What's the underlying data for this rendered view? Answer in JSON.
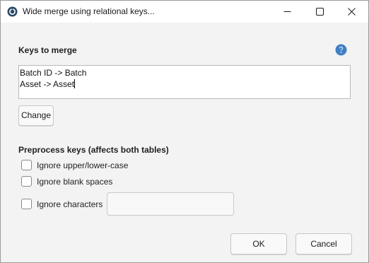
{
  "window": {
    "title": "Wide merge using relational keys...",
    "icons": {
      "app": "app-logo-icon",
      "minimize": "minimize-icon",
      "maximize": "maximize-icon",
      "close": "close-icon"
    }
  },
  "keys_section": {
    "label": "Keys to merge",
    "help_icon": "question-mark-icon",
    "help_color": "#3f7fc4",
    "keys": [
      "Batch ID -> Batch",
      "Asset -> Asset"
    ],
    "change_button": "Change"
  },
  "preprocess_section": {
    "label": "Preprocess keys (affects both tables)",
    "options": [
      {
        "label": "Ignore upper/lower-case",
        "checked": false
      },
      {
        "label": "Ignore blank spaces",
        "checked": false
      },
      {
        "label": "Ignore characters",
        "checked": false
      }
    ],
    "ignore_characters_value": ""
  },
  "footer": {
    "ok_label": "OK",
    "cancel_label": "Cancel"
  }
}
